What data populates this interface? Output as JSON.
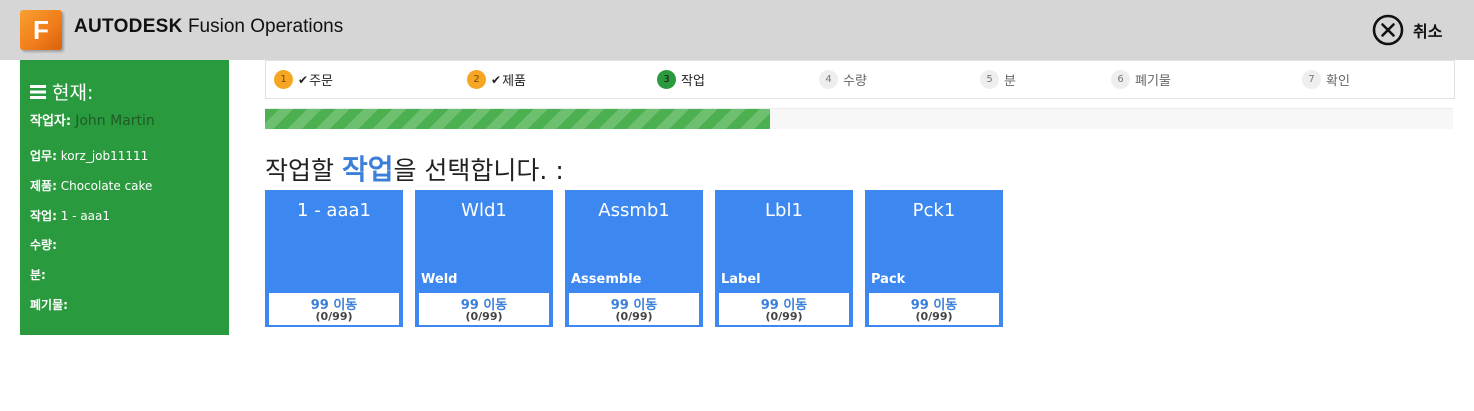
{
  "header": {
    "logo_letter": "F",
    "brand": "AUTODESK",
    "product": "Fusion Operations",
    "cancel_label": "취소"
  },
  "sidebar": {
    "title": "현재:",
    "worker_label": "작업자:",
    "worker_value": "John Martin",
    "job_label": "업무:",
    "job_value": "korz_job11111",
    "product_label": "제품:",
    "product_value": "Chocolate cake",
    "operation_label": "작업:",
    "operation_value": "1 - aaa1",
    "quantity_label": "수량:",
    "minutes_label": "분:",
    "scrap_label": "폐기물:"
  },
  "steps": [
    {
      "num": "1",
      "label": "주문",
      "status": "done"
    },
    {
      "num": "2",
      "label": "제품",
      "status": "done"
    },
    {
      "num": "3",
      "label": "작업",
      "status": "active"
    },
    {
      "num": "4",
      "label": "수량",
      "status": "pending"
    },
    {
      "num": "5",
      "label": "분",
      "status": "pending"
    },
    {
      "num": "6",
      "label": "폐기물",
      "status": "pending"
    },
    {
      "num": "7",
      "label": "확인",
      "status": "pending"
    }
  ],
  "progress": {
    "fraction": 0.425
  },
  "heading": {
    "pre": "작업할 ",
    "emph": "작업",
    "post": "을 선택합니다. :"
  },
  "cards": [
    {
      "title": "1 - aaa1",
      "subtitle": "",
      "move": "99 이동",
      "count": "(0/99)"
    },
    {
      "title": "Wld1",
      "subtitle": "Weld",
      "move": "99 이동",
      "count": "(0/99)"
    },
    {
      "title": "Assmb1",
      "subtitle": "Assemble",
      "move": "99 이동",
      "count": "(0/99)"
    },
    {
      "title": "Lbl1",
      "subtitle": "Label",
      "move": "99 이동",
      "count": "(0/99)"
    },
    {
      "title": "Pck1",
      "subtitle": "Pack",
      "move": "99 이동",
      "count": "(0/99)"
    }
  ],
  "colors": {
    "header_bg": "#d6d6d6",
    "sidebar_bg": "#2a9a3e",
    "card_bg": "#3d87f0",
    "accent_text": "#3b7fd9",
    "step_done": "#f5a623",
    "step_active": "#2a9a3e"
  }
}
